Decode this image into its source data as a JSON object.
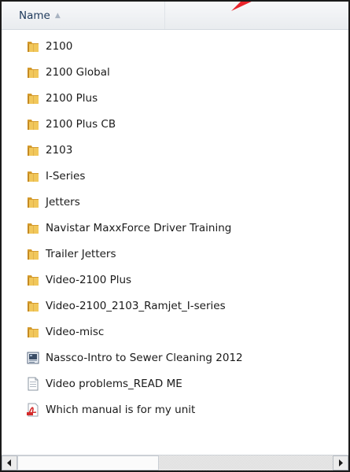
{
  "header": {
    "name_column": "Name"
  },
  "files": [
    {
      "label": "2100",
      "icon": "folder-icon"
    },
    {
      "label": "2100 Global",
      "icon": "folder-icon"
    },
    {
      "label": "2100 Plus",
      "icon": "folder-icon"
    },
    {
      "label": "2100 Plus CB",
      "icon": "folder-icon"
    },
    {
      "label": "2103",
      "icon": "folder-icon"
    },
    {
      "label": "I-Series",
      "icon": "folder-icon"
    },
    {
      "label": "Jetters",
      "icon": "folder-icon"
    },
    {
      "label": "Navistar MaxxForce Driver Training",
      "icon": "folder-icon"
    },
    {
      "label": "Trailer Jetters",
      "icon": "folder-icon"
    },
    {
      "label": "Video-2100 Plus",
      "icon": "folder-icon"
    },
    {
      "label": "Video-2100_2103_Ramjet_I-series",
      "icon": "folder-icon"
    },
    {
      "label": "Video-misc",
      "icon": "folder-icon"
    },
    {
      "label": "Nassco-Intro to Sewer Cleaning 2012",
      "icon": "video-file-icon"
    },
    {
      "label": "Video problems_READ ME",
      "icon": "text-file-icon"
    },
    {
      "label": "Which manual is for my unit",
      "icon": "pdf-file-icon"
    }
  ],
  "colors": {
    "annotation_arrow": "#e8232a",
    "folder": "#e9b84a",
    "pdf": "#d42a2a"
  }
}
